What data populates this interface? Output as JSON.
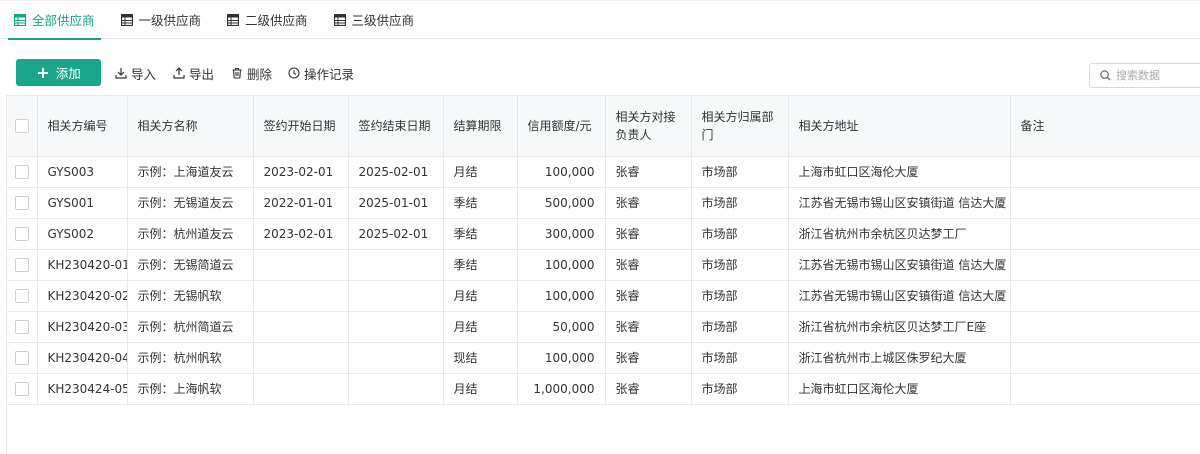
{
  "tabs": [
    {
      "label": "全部供应商",
      "active": true
    },
    {
      "label": "一级供应商",
      "active": false
    },
    {
      "label": "二级供应商",
      "active": false
    },
    {
      "label": "三级供应商",
      "active": false
    }
  ],
  "toolbar": {
    "add_label": "添加",
    "import_label": "导入",
    "export_label": "导出",
    "delete_label": "删除",
    "log_label": "操作记录"
  },
  "search": {
    "placeholder": "搜索数据"
  },
  "colors": {
    "accent": "#1aa68a",
    "header_bg": "#f7f8fa",
    "border": "#e8e8e8"
  },
  "table": {
    "columns": [
      "相关方编号",
      "相关方名称",
      "签约开始日期",
      "签约结束日期",
      "结算期限",
      "信用额度/元",
      "相关方对接负责人",
      "相关方归属部门",
      "相关方地址",
      "备注"
    ],
    "rows": [
      [
        "GYS003",
        "示例：上海道友云",
        "2023-02-01",
        "2025-02-01",
        "月结",
        "100,000",
        "张睿",
        "市场部",
        "上海市虹口区海伦大厦",
        ""
      ],
      [
        "GYS001",
        "示例：无锡道友云",
        "2022-01-01",
        "2025-01-01",
        "季结",
        "500,000",
        "张睿",
        "市场部",
        "江苏省无锡市锡山区安镇街道 信达大厦",
        ""
      ],
      [
        "GYS002",
        "示例：杭州道友云",
        "2023-02-01",
        "2025-02-01",
        "季结",
        "300,000",
        "张睿",
        "市场部",
        "浙江省杭州市余杭区贝达梦工厂",
        ""
      ],
      [
        "KH230420-01",
        "示例：无锡简道云",
        "",
        "",
        "季结",
        "100,000",
        "张睿",
        "市场部",
        "江苏省无锡市锡山区安镇街道 信达大厦",
        ""
      ],
      [
        "KH230420-02",
        "示例：无锡帆软",
        "",
        "",
        "月结",
        "100,000",
        "张睿",
        "市场部",
        "江苏省无锡市锡山区安镇街道 信达大厦",
        ""
      ],
      [
        "KH230420-03",
        "示例：杭州简道云",
        "",
        "",
        "月结",
        "50,000",
        "张睿",
        "市场部",
        "浙江省杭州市余杭区贝达梦工厂E座",
        ""
      ],
      [
        "KH230420-04",
        "示例：杭州帆软",
        "",
        "",
        "现结",
        "100,000",
        "张睿",
        "市场部",
        "浙江省杭州市上城区侏罗纪大厦",
        ""
      ],
      [
        "KH230424-05",
        "示例：上海帆软",
        "",
        "",
        "月结",
        "1,000,000",
        "张睿",
        "市场部",
        "上海市虹口区海伦大厦",
        ""
      ]
    ]
  }
}
